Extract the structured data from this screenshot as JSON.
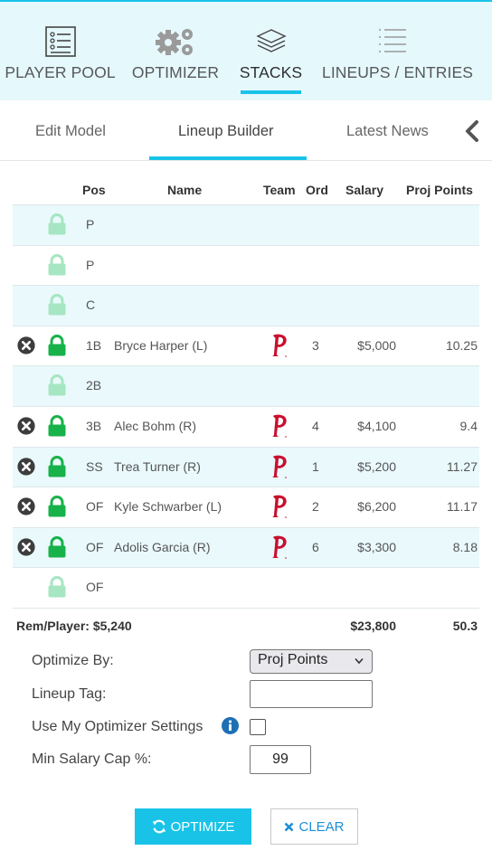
{
  "nav": {
    "items": [
      {
        "label": "PLAYER POOL",
        "icon": "player-pool-list-icon",
        "active": false
      },
      {
        "label": "OPTIMIZER",
        "icon": "gears-icon",
        "active": false
      },
      {
        "label": "STACKS",
        "icon": "layers-icon",
        "active": true
      },
      {
        "label": "LINEUPS / ENTRIES",
        "icon": "list-lines-icon",
        "active": false
      }
    ]
  },
  "subtabs": {
    "items": [
      {
        "label": "Edit Model",
        "active": false
      },
      {
        "label": "Lineup Builder",
        "active": true
      },
      {
        "label": "Latest News",
        "active": false
      }
    ],
    "collapse_icon": "chevron-left-icon"
  },
  "table": {
    "headers": {
      "pos": "Pos",
      "name": "Name",
      "team": "Team",
      "ord": "Ord",
      "salary": "Salary",
      "proj": "Proj Points"
    },
    "rows": [
      {
        "pos": "P",
        "name": "",
        "ord": "",
        "salary": "",
        "proj": "",
        "filled": false
      },
      {
        "pos": "P",
        "name": "",
        "ord": "",
        "salary": "",
        "proj": "",
        "filled": false
      },
      {
        "pos": "C",
        "name": "",
        "ord": "",
        "salary": "",
        "proj": "",
        "filled": false
      },
      {
        "pos": "1B",
        "name": "Bryce Harper (L)",
        "team_logo": "phillies-p-logo",
        "ord": "3",
        "salary": "$5,000",
        "proj": "10.25",
        "filled": true
      },
      {
        "pos": "2B",
        "name": "",
        "ord": "",
        "salary": "",
        "proj": "",
        "filled": false
      },
      {
        "pos": "3B",
        "name": "Alec Bohm (R)",
        "team_logo": "phillies-p-logo",
        "ord": "4",
        "salary": "$4,100",
        "proj": "9.4",
        "filled": true
      },
      {
        "pos": "SS",
        "name": "Trea Turner (R)",
        "team_logo": "phillies-p-logo",
        "ord": "1",
        "salary": "$5,200",
        "proj": "11.27",
        "filled": true
      },
      {
        "pos": "OF",
        "name": "Kyle Schwarber (L)",
        "team_logo": "phillies-p-logo",
        "ord": "2",
        "salary": "$6,200",
        "proj": "11.17",
        "filled": true
      },
      {
        "pos": "OF",
        "name": "Adolis Garcia (R)",
        "team_logo": "phillies-p-logo",
        "ord": "6",
        "salary": "$3,300",
        "proj": "8.18",
        "filled": true
      },
      {
        "pos": "OF",
        "name": "",
        "ord": "",
        "salary": "",
        "proj": "",
        "filled": false
      }
    ],
    "footer": {
      "rem_player": "Rem/Player: $5,240",
      "salary_total": "$23,800",
      "proj_total": "50.3"
    }
  },
  "form": {
    "optimize_by_label": "Optimize By:",
    "optimize_by_value": "Proj Points",
    "lineup_tag_label": "Lineup Tag:",
    "lineup_tag_value": "",
    "use_settings_label": "Use My Optimizer Settings",
    "use_settings_checked": false,
    "min_salary_label": "Min Salary Cap %:",
    "min_salary_value": "99"
  },
  "buttons": {
    "optimize": "OPTIMIZE",
    "clear": "CLEAR"
  },
  "colors": {
    "accent": "#19c3e8",
    "lock_filled": "#17b24a",
    "lock_empty": "#a6e6c2",
    "phillies_red": "#c8102e",
    "link_blue": "#1a8fd6"
  }
}
